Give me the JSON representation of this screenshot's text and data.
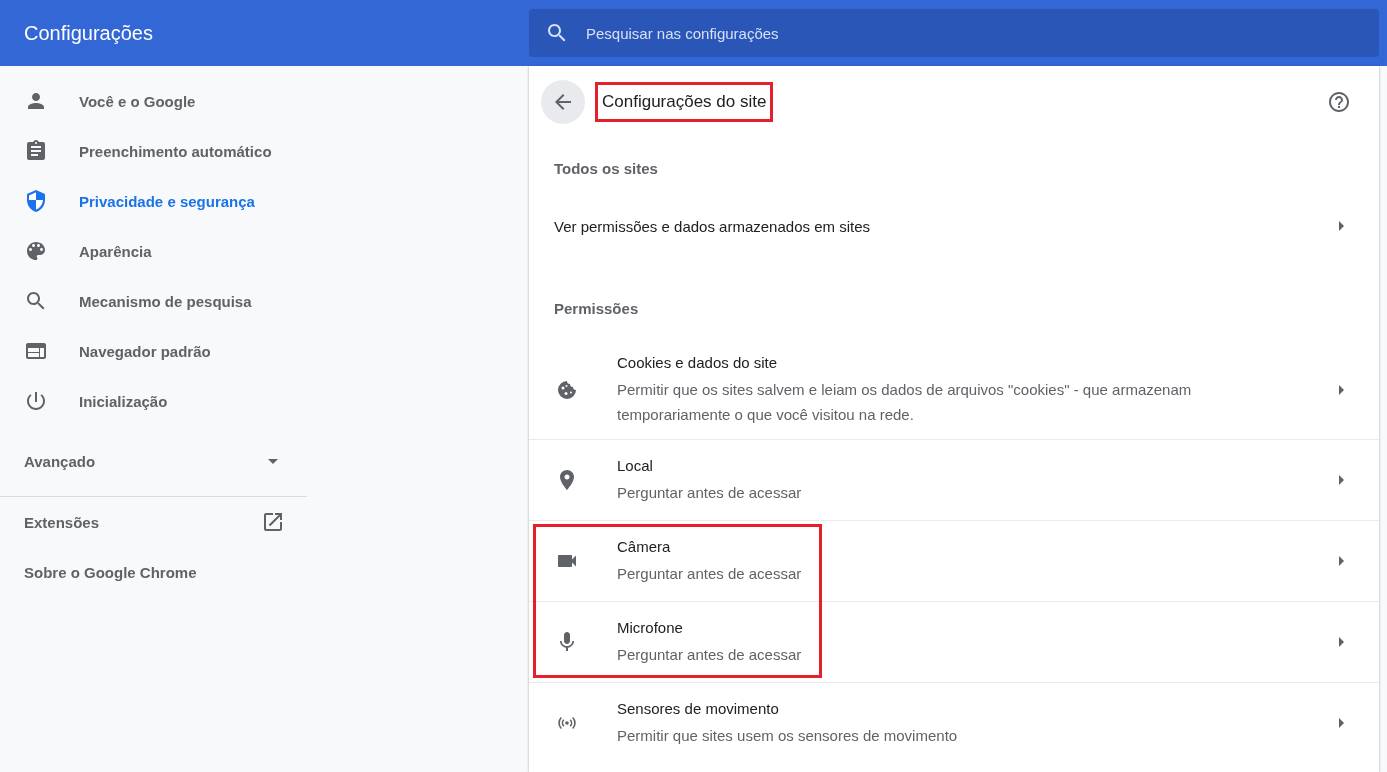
{
  "header": {
    "title": "Configurações",
    "search": {
      "placeholder": "Pesquisar nas configurações"
    }
  },
  "sidebar": {
    "items": [
      {
        "label": "Você e o Google",
        "selected": false
      },
      {
        "label": "Preenchimento automático",
        "selected": false
      },
      {
        "label": "Privacidade e segurança",
        "selected": true
      },
      {
        "label": "Aparência",
        "selected": false
      },
      {
        "label": "Mecanismo de pesquisa",
        "selected": false
      },
      {
        "label": "Navegador padrão",
        "selected": false
      },
      {
        "label": "Inicialização",
        "selected": false
      }
    ],
    "advanced": {
      "label": "Avançado",
      "expanded": false
    },
    "links": [
      {
        "label": "Extensões",
        "external": true
      },
      {
        "label": "Sobre o Google Chrome",
        "external": false
      }
    ]
  },
  "page": {
    "title": "Configurações do site",
    "title_highlighted": true,
    "all_sites": {
      "heading": "Todos os sites",
      "link": "Ver permissões e dados armazenados em sites"
    },
    "permissions": {
      "heading": "Permissões",
      "items": [
        {
          "title": "Cookies e dados do site",
          "description": "Permitir que os sites salvem e leiam os dados de arquivos \"cookies\" - que armazenam temporariamente o que você visitou na rede.",
          "highlighted": false
        },
        {
          "title": "Local",
          "description": "Perguntar antes de acessar",
          "highlighted": false
        },
        {
          "title": "Câmera",
          "description": "Perguntar antes de acessar",
          "highlighted": true
        },
        {
          "title": "Microfone",
          "description": "Perguntar antes de acessar",
          "highlighted": true
        },
        {
          "title": "Sensores de movimento",
          "description": "Permitir que sites usem os sensores de movimento",
          "highlighted": false
        }
      ]
    }
  }
}
